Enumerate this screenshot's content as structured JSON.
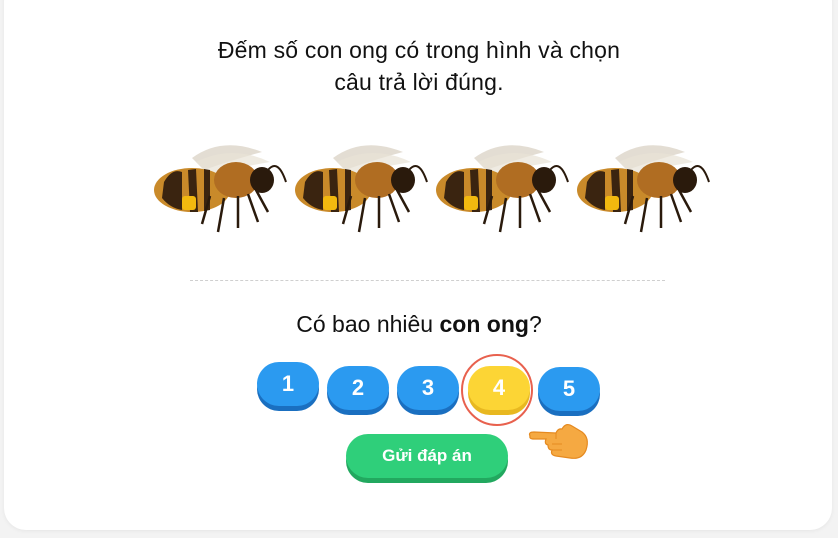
{
  "instruction_line1": "Đếm số con ong có trong hình và chọn",
  "instruction_line2": "câu trả lời đúng.",
  "bees": [
    {
      "icon": "bee-icon"
    },
    {
      "icon": "bee-icon"
    },
    {
      "icon": "bee-icon"
    },
    {
      "icon": "bee-icon"
    }
  ],
  "question": {
    "prefix": "Có bao nhiêu ",
    "emphasis": "con ong",
    "suffix": "?"
  },
  "options": [
    {
      "label": "1",
      "selected": false
    },
    {
      "label": "2",
      "selected": false
    },
    {
      "label": "3",
      "selected": false
    },
    {
      "label": "4",
      "selected": true
    },
    {
      "label": "5",
      "selected": false
    }
  ],
  "submit_label": "Gửi đáp án",
  "colors": {
    "option_blue": "#2b9af0",
    "option_selected": "#fcd535",
    "submit_green": "#2fcf7a",
    "highlight_ring": "#e8614e"
  }
}
